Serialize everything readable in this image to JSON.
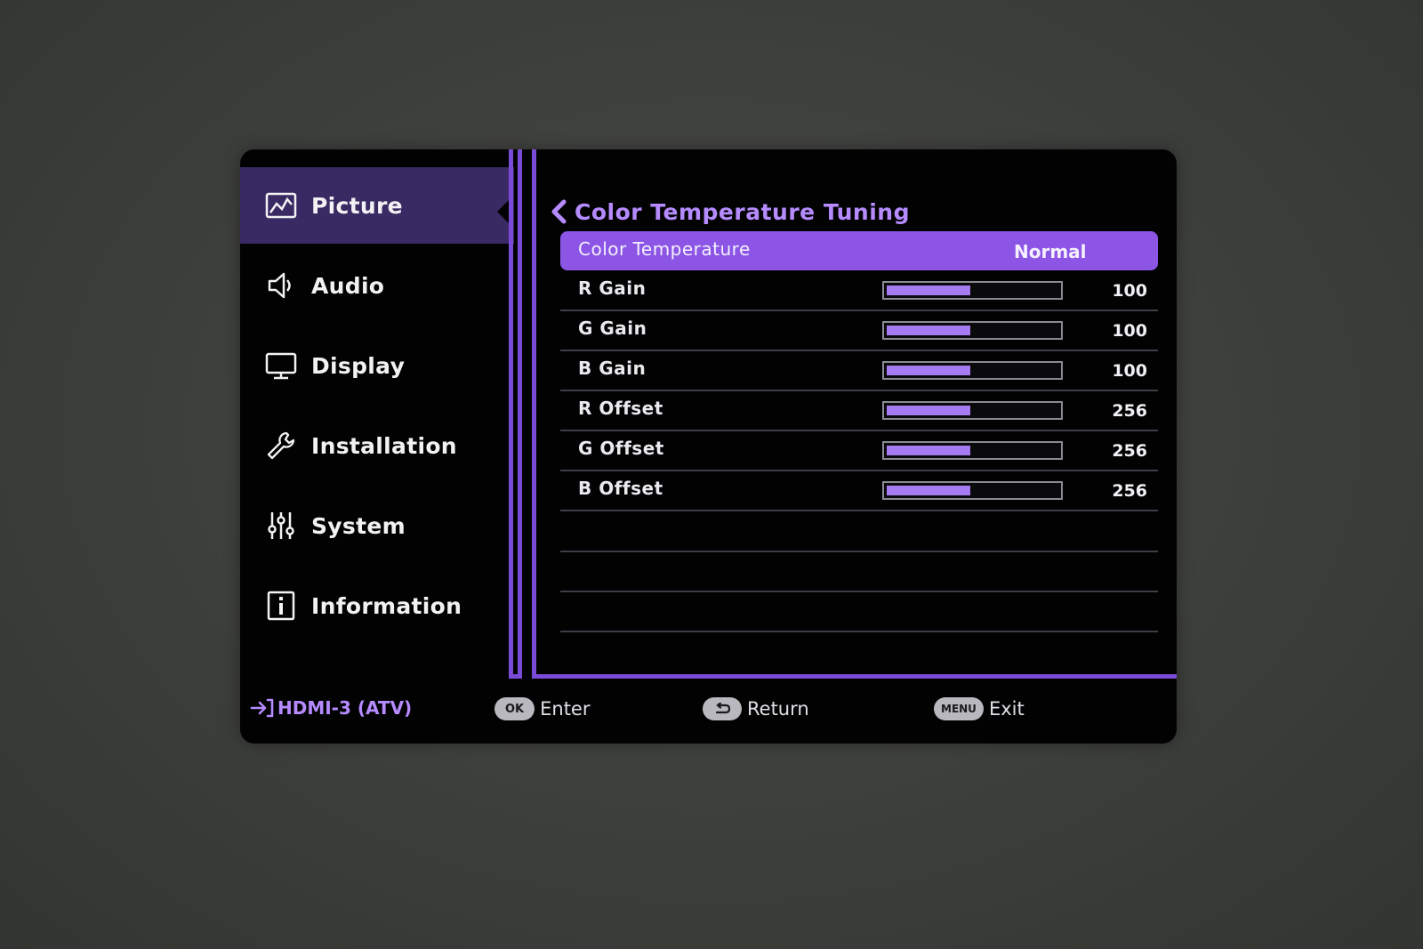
{
  "sidebar": {
    "items": [
      {
        "label": "Picture",
        "icon": "picture-icon",
        "active": true
      },
      {
        "label": "Audio",
        "icon": "speaker-icon",
        "active": false
      },
      {
        "label": "Display",
        "icon": "monitor-icon",
        "active": false
      },
      {
        "label": "Installation",
        "icon": "wrench-icon",
        "active": false
      },
      {
        "label": "System",
        "icon": "sliders-icon",
        "active": false
      },
      {
        "label": "Information",
        "icon": "info-icon",
        "active": false
      }
    ]
  },
  "content": {
    "title": "Color Temperature Tuning",
    "selected_row": {
      "label": "Color Temperature",
      "value": "Normal"
    },
    "rows": [
      {
        "label": "R Gain",
        "value": "100",
        "level": 0.5
      },
      {
        "label": "G Gain",
        "value": "100",
        "level": 0.5
      },
      {
        "label": "B Gain",
        "value": "100",
        "level": 0.5
      },
      {
        "label": "R Offset",
        "value": "256",
        "level": 0.5
      },
      {
        "label": "G Offset",
        "value": "256",
        "level": 0.5
      },
      {
        "label": "B Offset",
        "value": "256",
        "level": 0.5
      }
    ]
  },
  "footer": {
    "source": "HDMI-3 (ATV)",
    "ok_key": "OK",
    "ok_label": "Enter",
    "return_label": "Return",
    "menu_key": "MENU",
    "menu_label": "Exit"
  },
  "colors": {
    "accent": "#8c55e6",
    "accent_text": "#b58bff",
    "active_bg": "#3a2a63",
    "panel_bg": "#020203"
  }
}
